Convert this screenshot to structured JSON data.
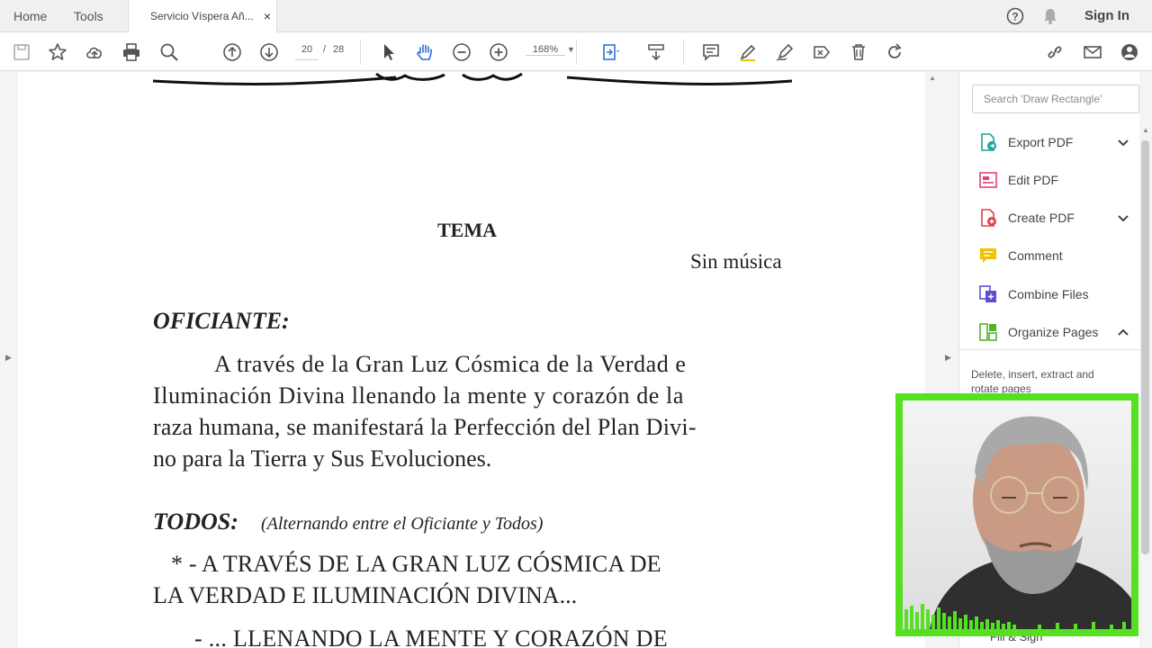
{
  "topbar": {
    "home": "Home",
    "tools": "Tools",
    "doc_tab": "Servicio Víspera Añ...",
    "close": "×",
    "help_icon": "help-icon",
    "bell_icon": "bell-icon",
    "sign_in": "Sign In"
  },
  "toolbar": {
    "page_current": "20",
    "page_separator": "/",
    "page_total": "28",
    "zoom": "168%"
  },
  "document": {
    "heading": "TEMA",
    "subheading": "Sin música",
    "speaker1": "OFICIANTE:",
    "para1_line1": "A través de la Gran Luz Cósmica de la Verdad e",
    "para1_line2": "Iluminación Divina llenando la mente y corazón de la",
    "para1_line3": "raza humana, se manifestará la Perfección del Plan Divi-",
    "para1_line4": "no para la Tierra y Sus Evoluciones.",
    "speaker2": "TODOS:",
    "speaker2_note": "(Alternando entre el Oficiante y Todos)",
    "verse1_line1": "* - A TRAVÉS DE LA GRAN LUZ CÓSMICA DE",
    "verse1_line2": "LA VERDAD E ILUMINACIÓN DIVINA...",
    "verse2_line1": "- ... LLENANDO LA MENTE Y CORAZÓN DE"
  },
  "panel": {
    "search_placeholder": "Search 'Draw Rectangle'",
    "tools": [
      {
        "label": "Export PDF",
        "icon": "export-pdf-icon",
        "color": "#1aa39b"
      },
      {
        "label": "Edit PDF",
        "icon": "edit-pdf-icon",
        "color": "#e0407b"
      },
      {
        "label": "Create PDF",
        "icon": "create-pdf-icon",
        "color": "#e0404a"
      },
      {
        "label": "Comment",
        "icon": "comment-icon",
        "color": "#f2c200"
      },
      {
        "label": "Combine Files",
        "icon": "combine-files-icon",
        "color": "#5b4fd6"
      },
      {
        "label": "Organize Pages",
        "icon": "organize-pages-icon",
        "color": "#4fb32e"
      }
    ],
    "organize_description": "Delete, insert, extract and rotate pages",
    "fill_sign": "Fill & Sign"
  },
  "colors": {
    "webcam_border": "#55e022",
    "accent_blue": "#2d6fd6"
  }
}
